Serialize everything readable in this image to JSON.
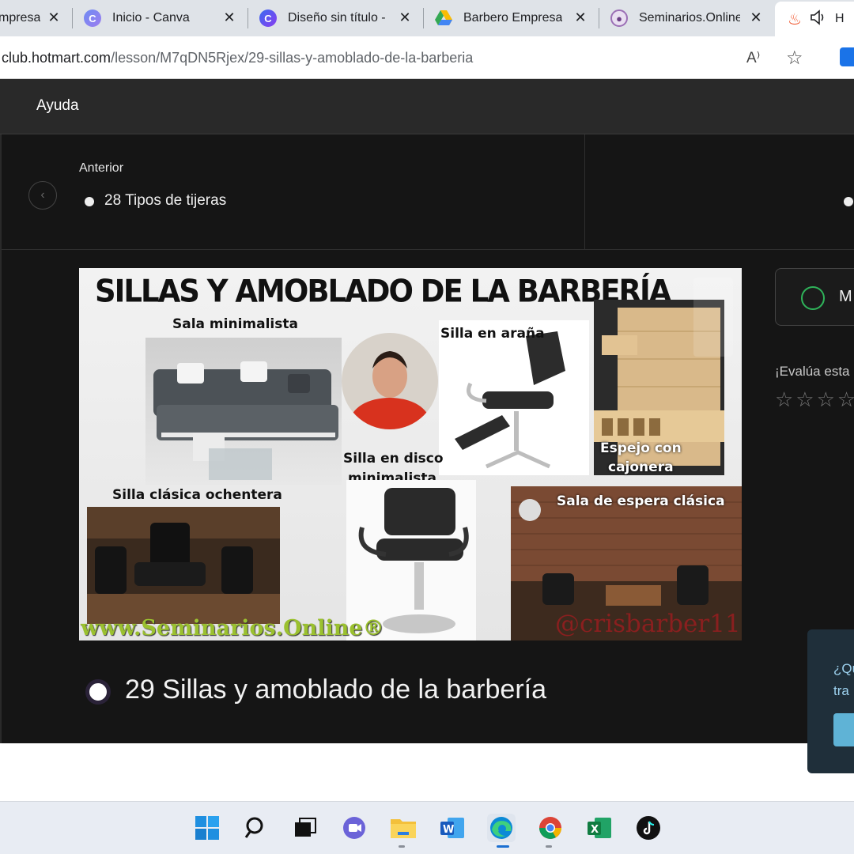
{
  "browser": {
    "tabs": [
      {
        "title": "Empresa",
        "visible": "mpresa",
        "icon": "generic-tab-icon"
      },
      {
        "title": "Inicio - Canva",
        "icon": "canva-icon"
      },
      {
        "title": "Diseño sin título -",
        "icon": "canva-icon"
      },
      {
        "title": "Barbero Empresa",
        "icon": "google-drive-icon"
      },
      {
        "title": "Seminarios.Online",
        "icon": "seminarios-icon"
      },
      {
        "title": "H",
        "icon": "hotmart-flame-icon"
      }
    ],
    "url_host": "club.hotmart.com",
    "url_path": "/lesson/M7qDN5Rjex/29-sillas-y-amoblado-de-la-barberia",
    "read_aloud_glyph": "A⁾",
    "favorite_glyph": "☆"
  },
  "header": {
    "help_label": "Ayuda"
  },
  "navigation": {
    "previous_caption": "Anterior",
    "previous_lesson": "28 Tipos de tijeras"
  },
  "video": {
    "title": "SILLAS Y AMOBLADO DE LA BARBERÍA",
    "captions": {
      "sala": "Sala minimalista",
      "arana": "Silla en araña",
      "disco_1": "Silla en disco",
      "disco_2": "minimalista",
      "espejo_1": "Espejo con",
      "espejo_2": "cajonera",
      "clasica": "Silla clásica ochentera",
      "espera": "Sala de espera clásica"
    },
    "watermark_site": "www.Seminarios.Online®",
    "watermark_handle": "@crisbarber11"
  },
  "lesson": {
    "title": "29 Sillas y amoblado de la barbería"
  },
  "sidebar": {
    "mark_label": "M",
    "rate_label": "¡Evalúa esta",
    "stars": "☆☆☆☆",
    "help_line1": "¿Qu",
    "help_line2": "tra"
  },
  "colors": {
    "accent_green": "#2fb35a",
    "help_card_bg": "#1f2f3a",
    "help_button": "#5fb3d6",
    "watermark_green": "#9bc12f"
  }
}
